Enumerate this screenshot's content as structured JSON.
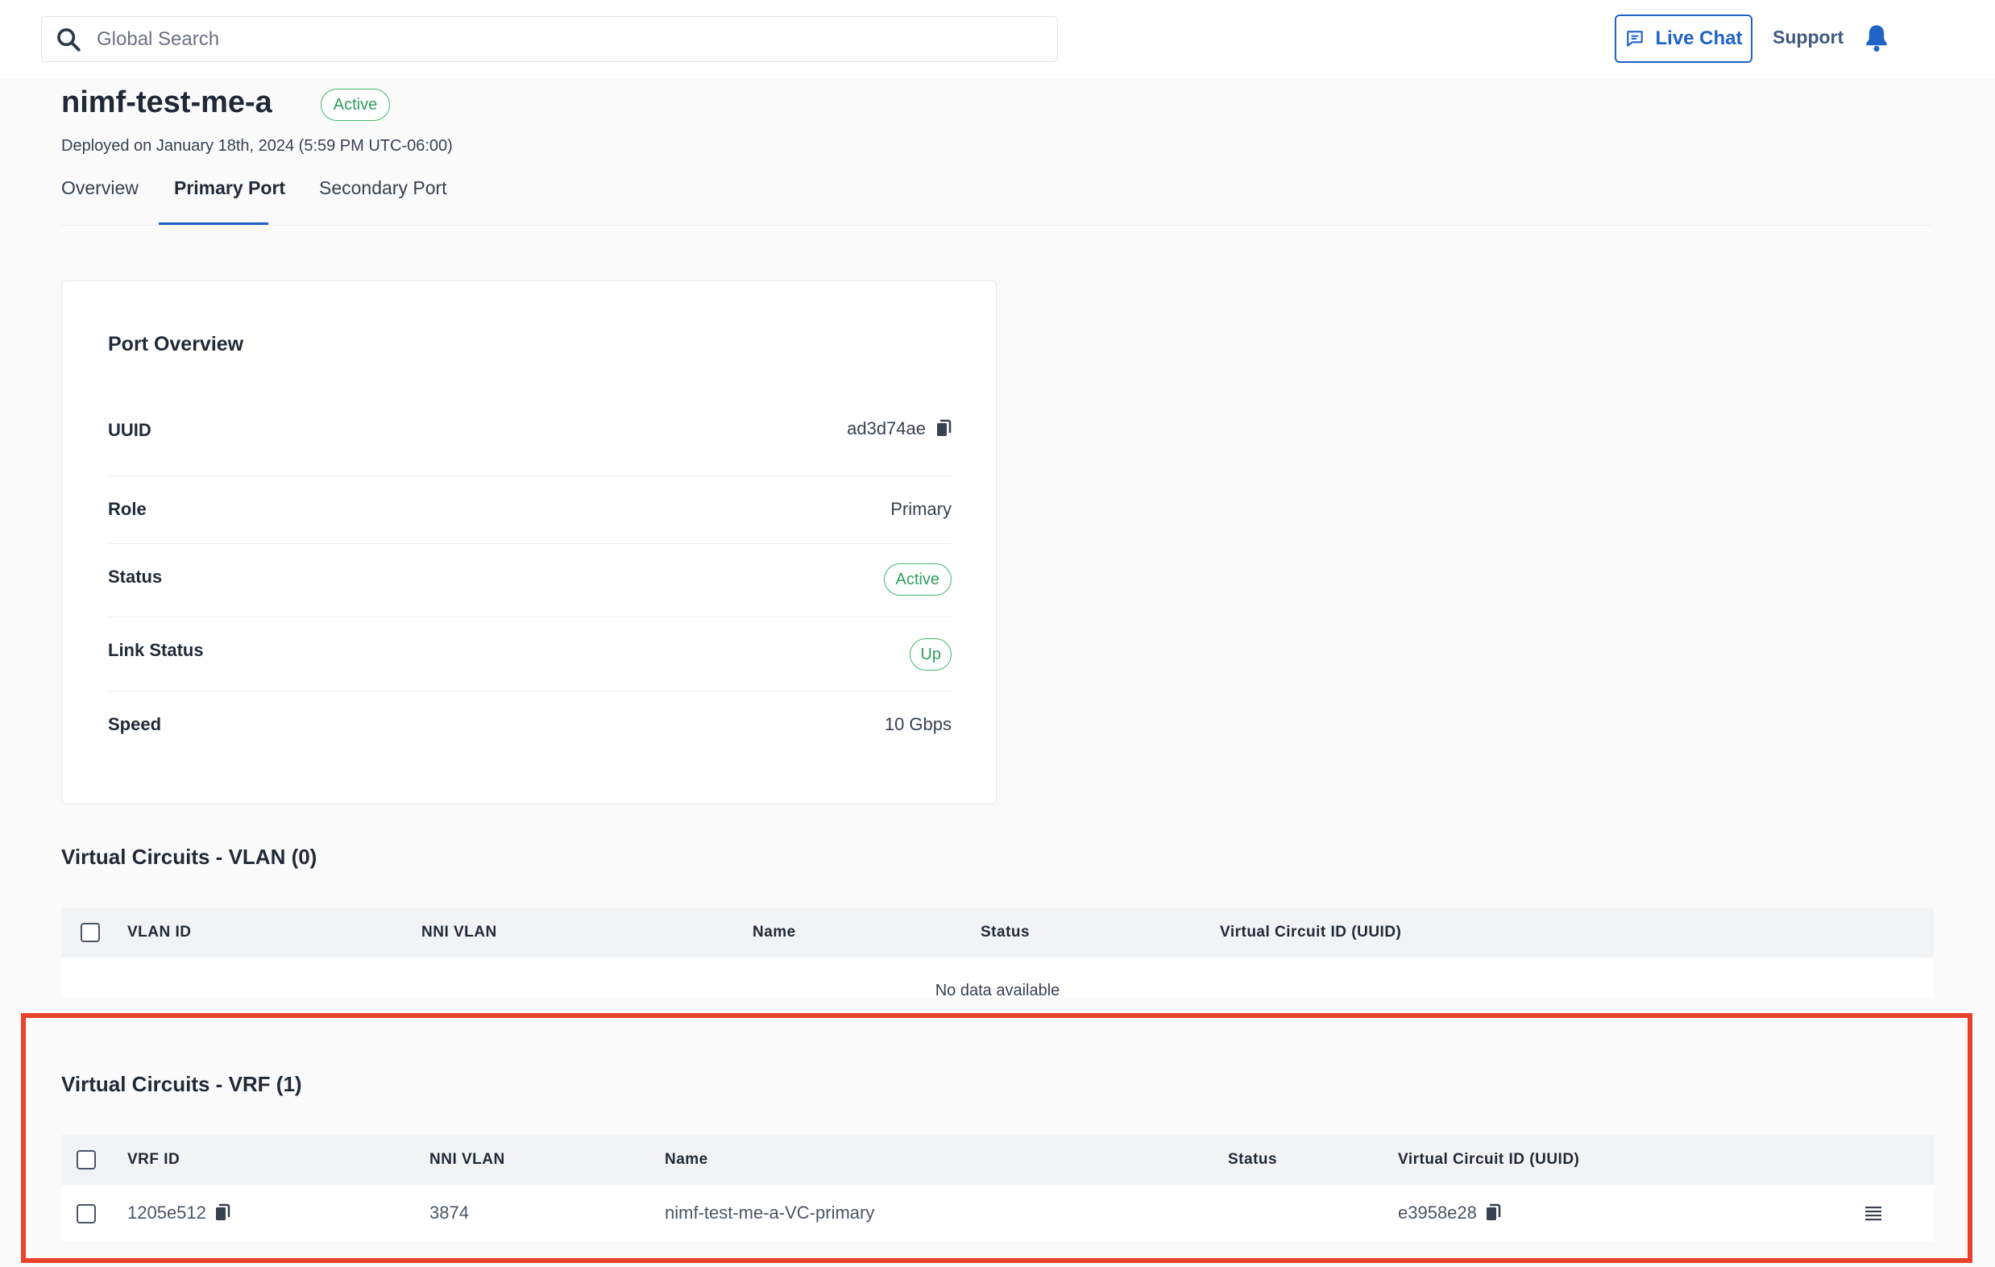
{
  "header": {
    "search_placeholder": "Global Search",
    "live_chat": "Live Chat",
    "support": "Support"
  },
  "page": {
    "title": "nimf-test-me-a",
    "status": "Active",
    "deployed": "Deployed on January 18th, 2024 (5:59 PM UTC-06:00)",
    "tabs": [
      {
        "label": "Overview"
      },
      {
        "label": "Primary Port"
      },
      {
        "label": "Secondary Port"
      }
    ],
    "active_tab": "Primary Port"
  },
  "port_overview": {
    "title": "Port Overview",
    "rows": [
      {
        "label": "UUID",
        "value": "ad3d74ae"
      },
      {
        "label": "Role",
        "value": "Primary"
      },
      {
        "label": "Status",
        "value": "Active"
      },
      {
        "label": "Link Status",
        "value": "Up"
      },
      {
        "label": "Speed",
        "value": "10 Gbps"
      }
    ]
  },
  "vlan_section": {
    "title": "Virtual Circuits - VLAN (0)",
    "columns": [
      "VLAN ID",
      "NNI VLAN",
      "Name",
      "Status",
      "Virtual Circuit ID (UUID)"
    ],
    "empty_text": "No data available"
  },
  "vrf_section": {
    "title": "Virtual Circuits - VRF (1)",
    "columns": [
      "VRF ID",
      "NNI VLAN",
      "Name",
      "Status",
      "Virtual Circuit ID (UUID)"
    ],
    "rows": [
      {
        "vrf_id": "1205e512",
        "nni_vlan": "3874",
        "name": "nimf-test-me-a-VC-primary",
        "status": "",
        "vc_id": "e3958e28"
      }
    ]
  },
  "colors": {
    "accent": "#1f63c6",
    "active_green": "#2f9b5c",
    "highlight": "#e8432a"
  }
}
